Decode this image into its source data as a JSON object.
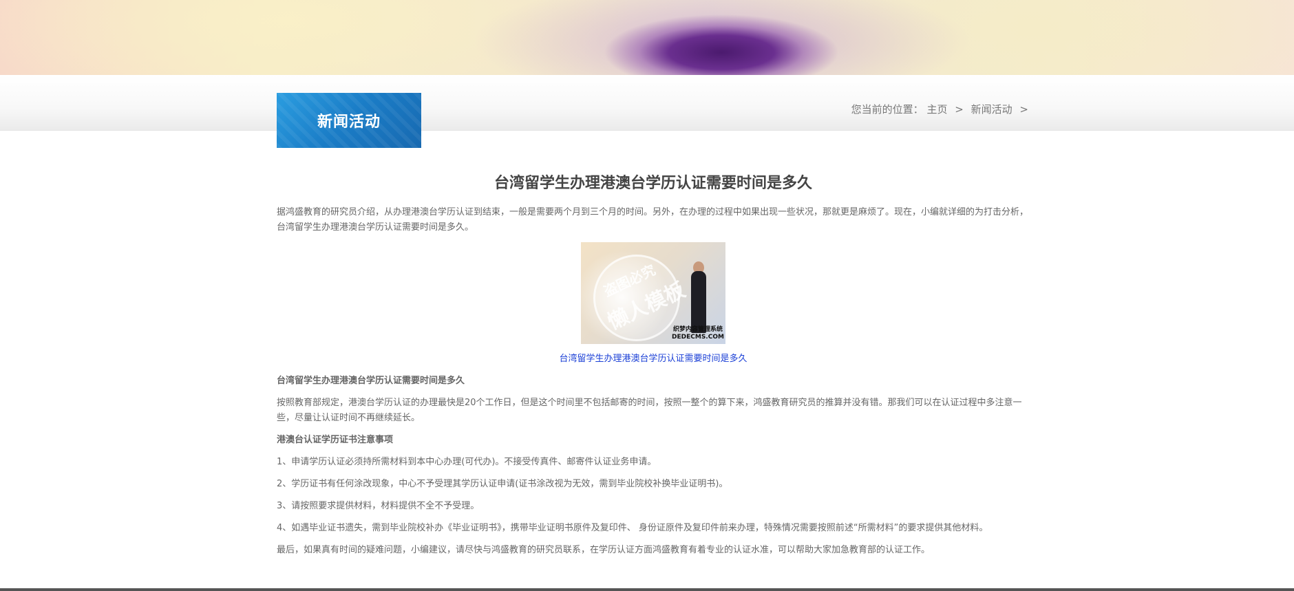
{
  "breadcrumb": {
    "prefix": "您当前的位置：",
    "home": "主页",
    "current": "新闻活动",
    "separator": ">"
  },
  "section": {
    "title": "新闻活动"
  },
  "article": {
    "title": "台湾留学生办理港澳台学历认证需要时间是多久",
    "intro": "据鸿盛教育的研究员介绍，从办理港澳台学历认证到结束，一般是需要两个月到三个月的时间。另外，在办理的过程中如果出现一些状况，那就更是麻烦了。现在，小编就详细的为打击分析，台湾留学生办理港澳台学历认证需要时间是多久。",
    "image": {
      "watermark_top": "盗图必究",
      "watermark_main": "懒人模板",
      "brand_line1": "织梦内容管理系统",
      "brand_line2": "DEDECMS.COM"
    },
    "caption": "台湾留学生办理港澳台学历认证需要时间是多久",
    "subheading1": "台湾留学生办理港澳台学历认证需要时间是多久",
    "para1": "按照教育部规定，港澳台学历认证的办理最快是20个工作日，但是这个时间里不包括邮寄的时间，按照一整个的算下来，鸿盛教育研究员的推算并没有错。那我们可以在认证过程中多注意一些，尽量让认证时间不再继续延长。",
    "subheading2": "港澳台认证学历证书注意事项",
    "items": [
      "1、申请学历认证必须持所需材料到本中心办理(可代办)。不接受传真件、邮寄件认证业务申请。",
      "2、学历证书有任何涂改现象，中心不予受理其学历认证申请(证书涂改视为无效，需到毕业院校补换毕业证明书)。",
      "3、请按照要求提供材料，材料提供不全不予受理。",
      "4、如遇毕业证书遗失，需到毕业院校补办《毕业证明书》，携带毕业证明书原件及复印件、 身份证原件及复印件前来办理，特殊情况需要按照前述“所需材料”的要求提供其他材料。"
    ],
    "closing": "最后，如果真有时间的疑难问题，小编建议，请尽快与鸿盛教育的研究员联系，在学历认证方面鸿盛教育有着专业的认证水准，可以帮助大家加急教育部的认证工作。"
  },
  "colors": {
    "section_box": "#1a7cc6",
    "caption_link": "#1a3fd6",
    "body_text": "#666666",
    "title_text": "#444444"
  }
}
